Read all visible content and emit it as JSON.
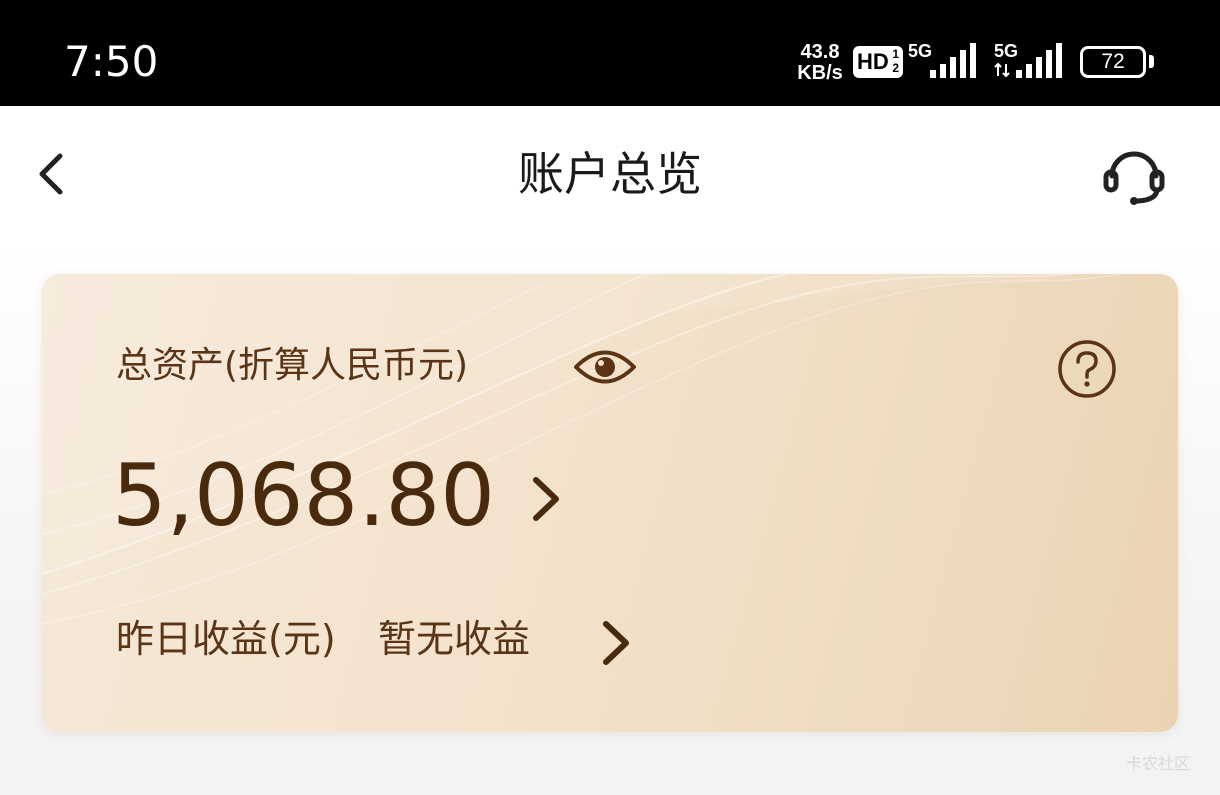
{
  "status_bar": {
    "time": "7:50",
    "net_speed_value": "43.8",
    "net_speed_unit": "KB/s",
    "hd_label": "HD",
    "hd_sub": "1",
    "hd_sub2": "2",
    "sim1_gen": "5G",
    "sim2_gen": "5G",
    "battery_level": "72"
  },
  "header": {
    "title": "账户总览",
    "back_icon": "chevron-left-icon",
    "support_icon": "headset-icon"
  },
  "asset_card": {
    "label": "总资产(折算人民币元)",
    "eye_icon": "eye-icon",
    "help_icon": "question-circle-icon",
    "amount": "5,068.80",
    "earnings_label": "昨日收益(元)",
    "earnings_value": "暂无收益",
    "text_color": "#5a3414",
    "amount_color": "#4a2a0c"
  },
  "watermark": "卡农社区"
}
